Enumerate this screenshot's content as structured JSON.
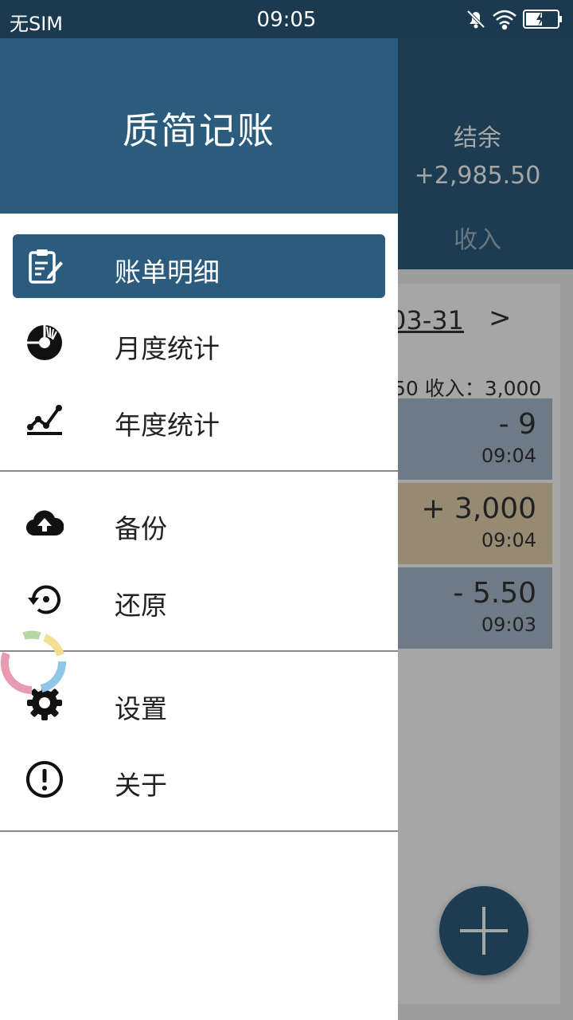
{
  "statusbar": {
    "carrier": "无SIM",
    "time": "09:05"
  },
  "background_app": {
    "balance_label": "结余",
    "balance_value": "+2,985.50",
    "income_tab": "收入",
    "date_fragment": "03-31",
    "next_arrow": ">",
    "summary": "50  收入：3,000",
    "records": [
      {
        "amount": "- 9",
        "time": "09:04",
        "color": "#a9bccc"
      },
      {
        "amount": "+ 3,000",
        "time": "09:04",
        "color": "#e6d6b0"
      },
      {
        "amount": "- 5.50",
        "time": "09:03",
        "color": "#a9bccc"
      }
    ]
  },
  "drawer": {
    "title": "质简记账",
    "items": [
      {
        "label": "账单明细",
        "icon": "bill-clipboard-icon",
        "active": true
      },
      {
        "label": "月度统计",
        "icon": "pie-chart-icon",
        "active": false
      },
      {
        "label": "年度统计",
        "icon": "line-chart-icon",
        "active": false
      },
      {
        "label": "备份",
        "icon": "cloud-upload-icon",
        "active": false
      },
      {
        "label": "还原",
        "icon": "restore-icon",
        "active": false
      },
      {
        "label": "设置",
        "icon": "gear-icon",
        "active": false
      },
      {
        "label": "关于",
        "icon": "info-exclamation-icon",
        "active": false
      }
    ]
  },
  "colors": {
    "primary": "#2c5c7d",
    "statusbar": "#1b3a4f"
  }
}
